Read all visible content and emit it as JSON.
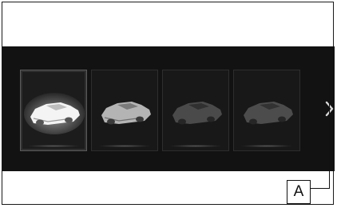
{
  "carousel": {
    "items": [
      {
        "name": "vehicle-1",
        "state": "selected",
        "body_color": "#f2f2f2"
      },
      {
        "name": "vehicle-2",
        "state": "normal",
        "body_color": "#a9a9a9"
      },
      {
        "name": "vehicle-3",
        "state": "dimmed",
        "body_color": "#4a4a4a"
      },
      {
        "name": "vehicle-4",
        "state": "dimmed",
        "body_color": "#4c4c4c"
      }
    ],
    "next_icon": "chevron-right-icon"
  },
  "callout": {
    "label": "A"
  },
  "colors": {
    "display_bg": "#121212",
    "frame": "#1a1a1a"
  }
}
